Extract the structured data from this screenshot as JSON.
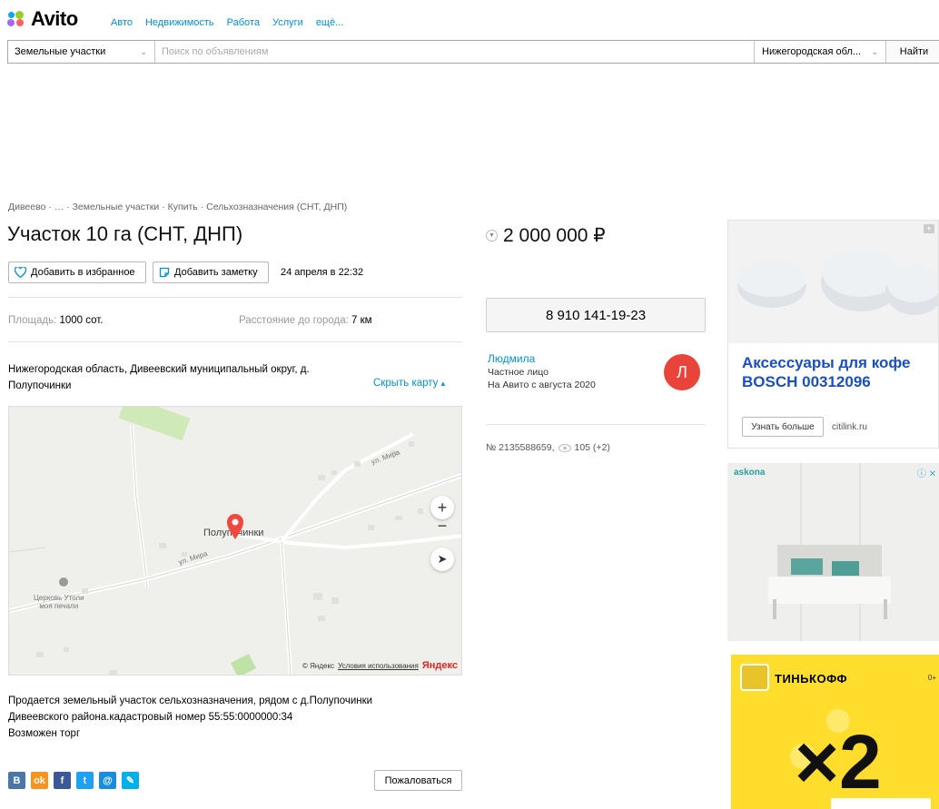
{
  "header": {
    "logo_text": "Avito",
    "nav": [
      "Авто",
      "Недвижимость",
      "Работа",
      "Услуги",
      "ещё..."
    ]
  },
  "search": {
    "category": "Земельные участки",
    "placeholder": "Поиск по объявлениям",
    "region": "Нижегородская обл...",
    "submit": "Найти"
  },
  "breadcrumbs": "Дивеево · … · Земельные участки · Купить · Сельхозназначения (СНТ, ДНП)",
  "listing": {
    "title": "Участок 10 га (СНТ, ДНП)",
    "favorite_label": "Добавить в избранное",
    "note_label": "Добавить заметку",
    "date": "24 апреля в 22:32",
    "params": [
      {
        "label": "Площадь: ",
        "value": "1000 сот."
      },
      {
        "label": "Расстояние до города: ",
        "value": "7 км"
      }
    ],
    "address": "Нижегородская область, Дивеевский муниципальный округ, д. Полупочинки",
    "hide_map": "Скрыть карту",
    "description": [
      "Продается земельный участок сельхозназначения, рядом с д.Полупочинки",
      "Дивеевского района.кадастровый номер 55:55:0000000:34",
      "Возможен торг"
    ],
    "complain": "Пожаловаться"
  },
  "map": {
    "village": "Полупочинки",
    "street1": "ул. Мира",
    "street2": "ул. Мира",
    "church_line1": "Церковь Утоли",
    "church_line2": "моя печали",
    "copyright": "© Яндекс",
    "terms": "Условия использования",
    "brand": "Яндекс",
    "zoom_in": "+",
    "zoom_out": "−"
  },
  "sidebar": {
    "price": "2 000 000 ₽",
    "phone": "8 910 141-19-23",
    "seller_name": "Людмила",
    "seller_type": "Частное лицо",
    "seller_since": "На Авито с августа 2020",
    "avatar_letter": "Л",
    "item_number": "№ 2135588659,",
    "views": "105 (+2)"
  },
  "social": {
    "icons": [
      "vk-icon",
      "odnoklassniki-icon",
      "facebook-icon",
      "twitter-icon",
      "mailru-icon",
      "livejournal-icon"
    ],
    "glyphs": [
      "В",
      "ok",
      "f",
      "t",
      "@",
      "✎"
    ],
    "colors": [
      "#4a76a8",
      "#f7931e",
      "#3b5998",
      "#1da1f2",
      "#168de2",
      "#00b0ea"
    ]
  },
  "ads": {
    "ad1_title": "Аксессуары для кофе BOSCH 00312096",
    "ad1_button": "Узнать больше",
    "ad1_domain": "citilink.ru",
    "ad2_brand": "askona",
    "ad3_brand": "ТИНЬКОФФ",
    "ad3_big": "×2",
    "ad3_age": "0+"
  },
  "colors": {
    "link": "#0091d9",
    "avatar": "#e8443a",
    "ad_title": "#1a4fc4",
    "map_pin": "#f0483e",
    "tinkoff_yellow": "#ffdd2d"
  }
}
